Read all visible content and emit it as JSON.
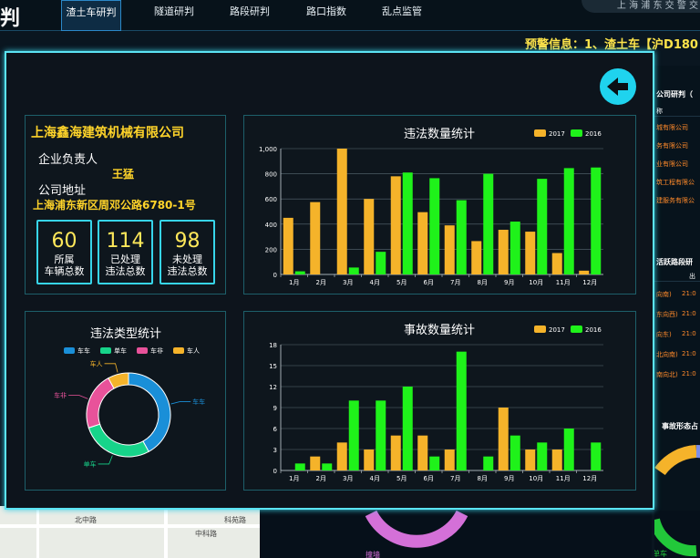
{
  "app": {
    "title_fragment": "判",
    "brand": "上 海 浦 东 交 警 交"
  },
  "nav": {
    "items": [
      "渣土车研判",
      "隧道研判",
      "路段研判",
      "路口指数",
      "乱点监管"
    ],
    "active_index": 0
  },
  "warning": {
    "text": "预警信息：1、渣土车【沪D180"
  },
  "map": {
    "labels": [
      "北中路",
      "中科路",
      "科苑路"
    ]
  },
  "right_panel": {
    "company_title": "公司研判（",
    "col_header": "称",
    "companies": [
      "城有限公司",
      "务有限公司",
      "业有限公司",
      "筑工程有限公",
      "建服务有限公"
    ],
    "route_title": "活跃路段研",
    "col_time": "出",
    "routes": [
      {
        "dir": "向南)",
        "time": "21:0"
      },
      {
        "dir": "东向西)",
        "time": "21:0"
      },
      {
        "dir": "向东)",
        "time": "21:0"
      },
      {
        "dir": "北向南)",
        "time": "21:0"
      },
      {
        "dir": "南向北)",
        "time": "21:0"
      }
    ],
    "accident_shape_title": "事故形态占",
    "bottom_label": "单车"
  },
  "bottom_mid": {
    "label": "撞墙"
  },
  "company": {
    "name": "上海鑫海建筑机械有限公司",
    "leader_label": "企业负责人",
    "leader": "王猛",
    "address_label": "公司地址",
    "address": "上海浦东新区周邓公路6780-1号",
    "stats": [
      {
        "value": "60",
        "label1": "所属",
        "label2": "车辆总数"
      },
      {
        "value": "114",
        "label1": "已处理",
        "label2": "违法总数"
      },
      {
        "value": "98",
        "label1": "未处理",
        "label2": "违法总数"
      }
    ]
  },
  "colors": {
    "s2017": "#f5b32a",
    "s2016": "#1ff21a",
    "car_car": "#1a8fd8",
    "single_car": "#17d48a",
    "car_nonmotor": "#e8529a",
    "car_person": "#f5b32a"
  },
  "chart_data": [
    {
      "type": "bar",
      "title": "违法数量统计",
      "categories": [
        "1月",
        "2月",
        "3月",
        "4月",
        "5月",
        "6月",
        "7月",
        "8月",
        "9月",
        "10月",
        "11月",
        "12月"
      ],
      "series": [
        {
          "name": "2017",
          "values": [
            450,
            575,
            1000,
            600,
            780,
            495,
            390,
            265,
            355,
            340,
            170,
            30
          ]
        },
        {
          "name": "2016",
          "values": [
            25,
            0,
            55,
            180,
            810,
            765,
            590,
            800,
            420,
            760,
            845,
            850
          ]
        }
      ],
      "ylim": [
        0,
        1000
      ],
      "yticks": [
        "0",
        "200",
        "400",
        "600",
        "800",
        "1,000"
      ],
      "legend": "top-right"
    },
    {
      "type": "pie",
      "title": "违法类型统计",
      "labels": [
        "车车",
        "单车",
        "车非",
        "车人"
      ],
      "values": [
        42,
        28,
        22,
        8
      ],
      "legend": "top"
    },
    {
      "type": "bar",
      "title": "事故数量统计",
      "categories": [
        "1月",
        "2月",
        "3月",
        "4月",
        "5月",
        "6月",
        "7月",
        "8月",
        "9月",
        "10月",
        "11月",
        "12月"
      ],
      "series": [
        {
          "name": "2017",
          "values": [
            0,
            2,
            4,
            3,
            5,
            5,
            3,
            0,
            9,
            3,
            3,
            0
          ]
        },
        {
          "name": "2016",
          "values": [
            1,
            1,
            10,
            10,
            12,
            2,
            17,
            2,
            5,
            4,
            6,
            4
          ]
        }
      ],
      "ylim": [
        0,
        18
      ],
      "yticks": [
        "0",
        "3",
        "6",
        "9",
        "12",
        "15",
        "18"
      ],
      "legend": "top-right"
    }
  ]
}
